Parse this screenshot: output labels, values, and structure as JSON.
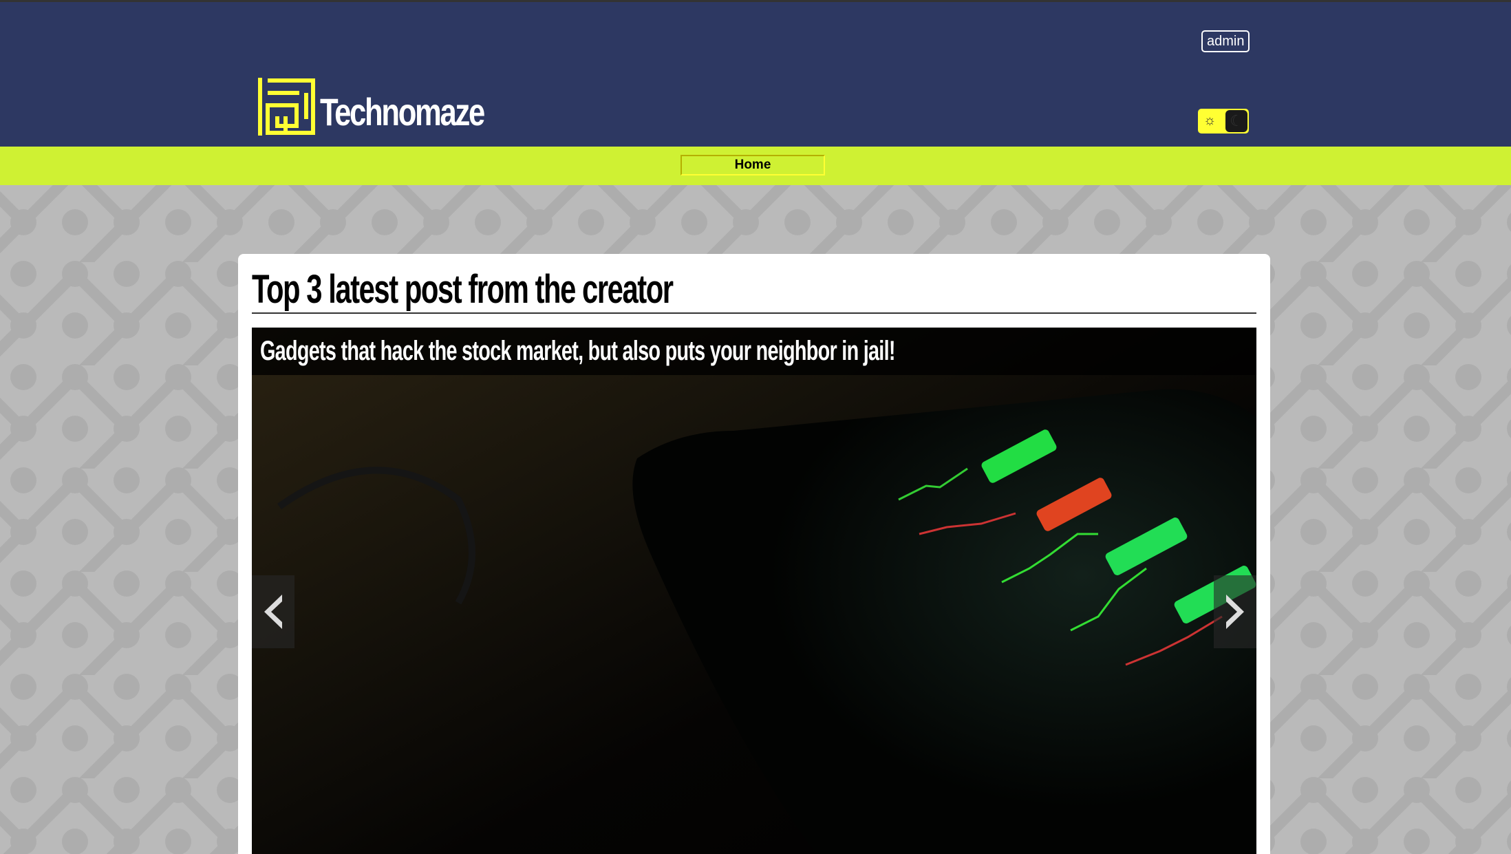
{
  "header": {
    "brand": "Technomaze",
    "user_button": "admin",
    "theme_toggle": {
      "light_icon": "sun-icon",
      "dark_icon": "moon-icon",
      "mode": "dark"
    }
  },
  "nav": {
    "items": [
      {
        "label": "Home",
        "active": true
      }
    ]
  },
  "main": {
    "title": "Top 3 latest post from the creator",
    "carousel": {
      "current_caption": "Gadgets that hack the stock market, but also puts your neighbor in jail!",
      "prev_icon": "chevron-left-icon",
      "next_icon": "chevron-right-icon"
    }
  },
  "colors": {
    "header_bg": "#2d3862",
    "nav_bg": "#cff133",
    "accent_yellow": "#ffff33",
    "page_bg": "#bababa"
  }
}
